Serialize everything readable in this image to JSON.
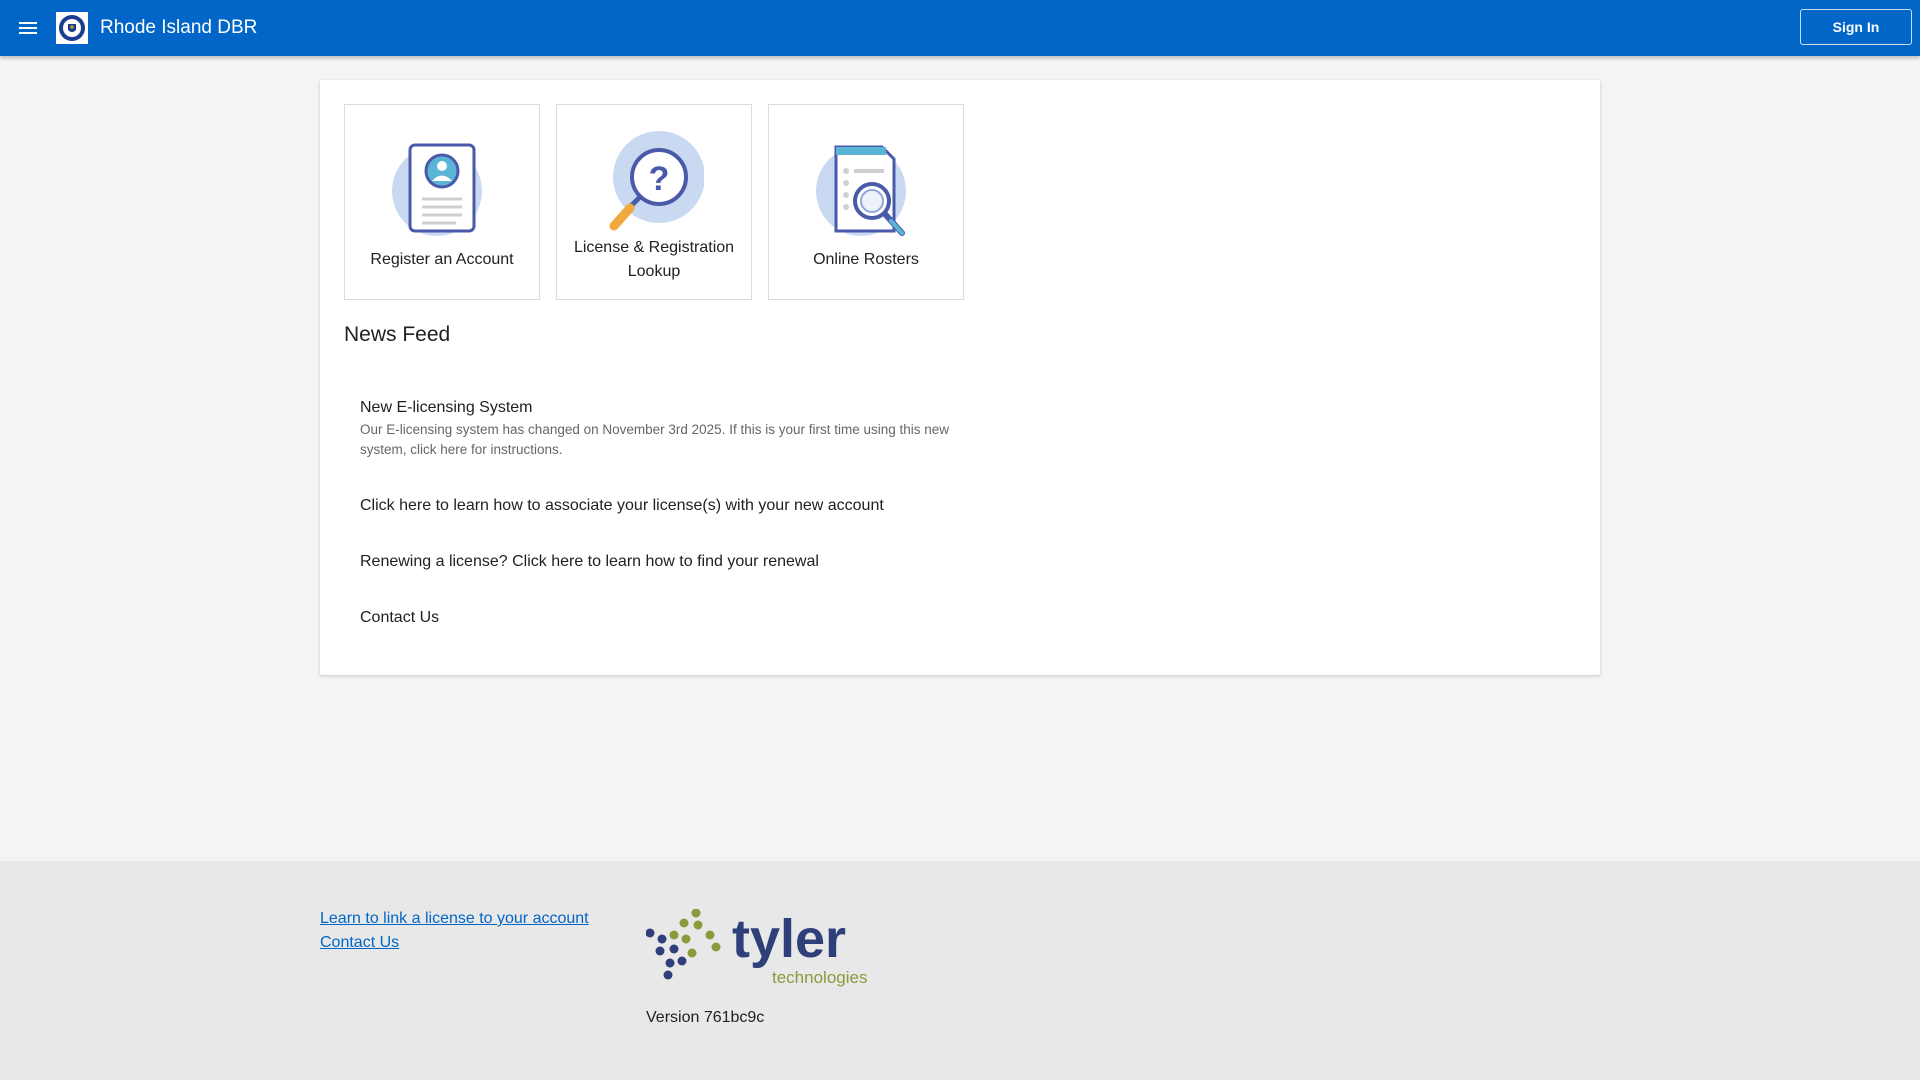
{
  "header": {
    "title": "Rhode Island DBR",
    "menu_icon": "hamburger-menu-icon",
    "signin_label": "Sign In",
    "brand_color": "#0266c8"
  },
  "tiles": [
    {
      "label": "Register an Account",
      "icon": "account-card-icon"
    },
    {
      "label": "License & Registration Lookup",
      "icon": "magnifier-question-icon"
    },
    {
      "label": "Online Rosters",
      "icon": "document-search-icon"
    }
  ],
  "news": {
    "title": "News Feed",
    "items": [
      {
        "title": "New E-licensing System",
        "description": "Our E-licensing system has changed on November 3rd 2025. If this is your first time using this new system, click here for instructions."
      },
      {
        "title": "Click here to learn how to associate your license(s) with your new account"
      },
      {
        "title": "Renewing a license? Click here to learn how to find your renewal"
      },
      {
        "title": "Contact Us"
      }
    ]
  },
  "footer": {
    "links": [
      "Learn to link a license to your account",
      "Contact Us"
    ],
    "brand_name": "tyler",
    "brand_sub": "technologies",
    "version": "Version 761bc9c"
  }
}
